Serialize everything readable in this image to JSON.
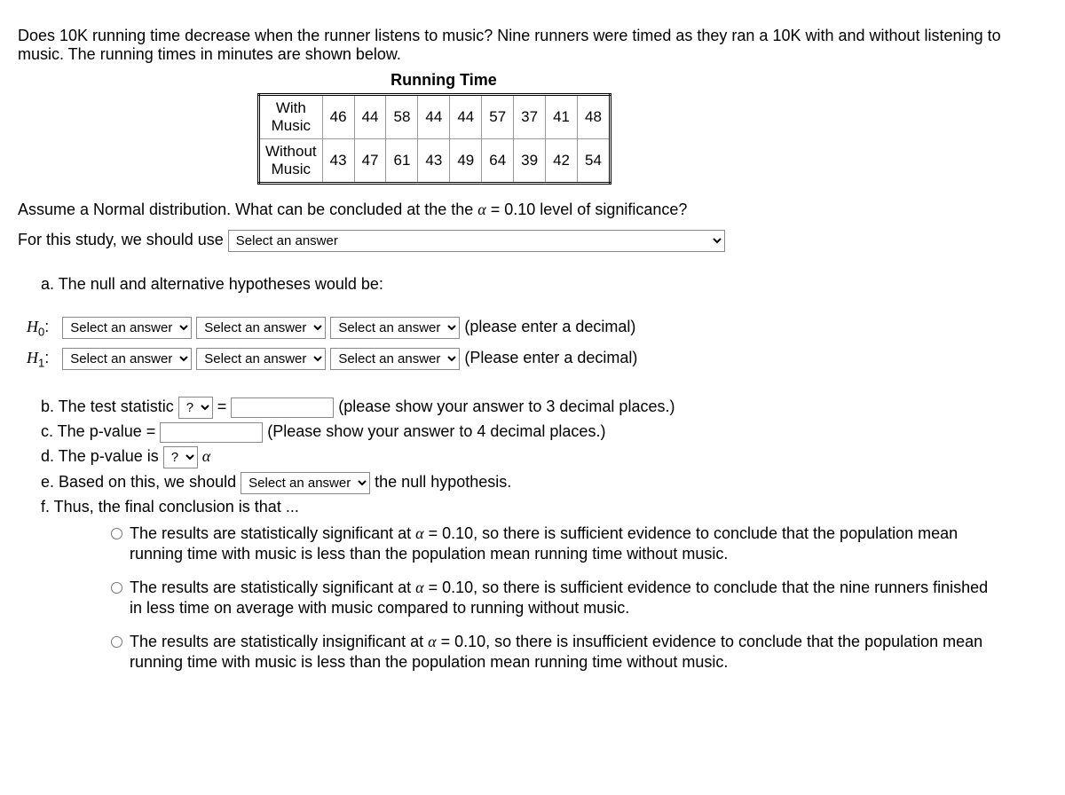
{
  "intro": "Does 10K running time decrease when the runner listens to music? Nine runners were timed as they ran a 10K with and without listening to music. The running times in minutes are shown below.",
  "table_title": "Running Time",
  "table": {
    "rows": [
      {
        "label": "With Music",
        "values": [
          "46",
          "44",
          "58",
          "44",
          "44",
          "57",
          "37",
          "41",
          "48"
        ]
      },
      {
        "label": "Without Music",
        "values": [
          "43",
          "47",
          "61",
          "43",
          "49",
          "64",
          "39",
          "42",
          "54"
        ]
      }
    ]
  },
  "assume_line_pre": "Assume a Normal distribution.  What can be concluded at the the ",
  "alpha": "α",
  "assume_line_post": " = 0.10 level of significance?",
  "study_line": "For this study, we should use ",
  "select_placeholder": "Select an answer",
  "question_placeholder": "?",
  "part_a": "a. The null and alternative hypotheses would be:",
  "h0_label_pre": "H",
  "h0_sub": "0",
  "h1_sub": "1",
  "colon": ":",
  "h0_tail": "(please enter a decimal)",
  "h1_tail": "(Please enter a decimal)",
  "part_b_pre": "b. The test statistic ",
  "equals": " = ",
  "part_b_tail": " (please show your answer to 3 decimal places.)",
  "part_c_pre": "c. The p-value = ",
  "part_c_tail": " (Please show your answer to 4 decimal places.)",
  "part_d_pre": "d. The p-value is ",
  "part_e_pre": "e. Based on this, we should ",
  "part_e_post": " the null hypothesis.",
  "part_f": "f. Thus, the final conclusion is that ...",
  "conclusions": [
    "The results are statistically significant at α = 0.10, so there is sufficient evidence to conclude that the population mean running time with music is less than the population mean running time without music.",
    "The results are statistically significant at α = 0.10, so there is sufficient evidence to conclude that the nine runners finished in less time on average with music compared to running without music.",
    "The results are statistically insignificant at α = 0.10, so there is insufficient evidence to conclude that the population mean running time with music is less than the population mean running time without music."
  ]
}
